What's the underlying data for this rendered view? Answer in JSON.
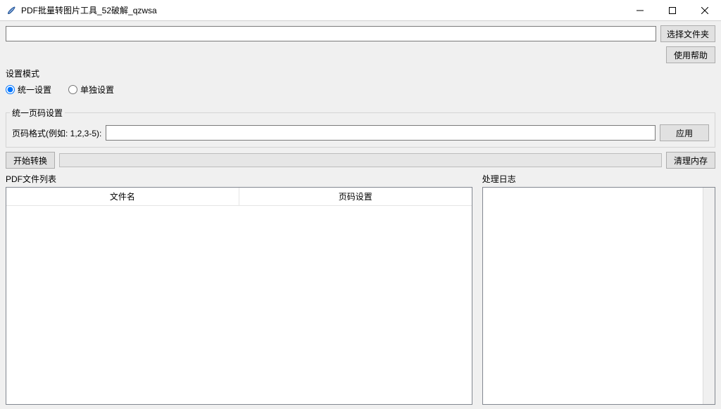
{
  "window": {
    "title": "PDF批量转图片工具_52破解_qzwsa"
  },
  "toolbar": {
    "path_value": "",
    "choose_folder_label": "选择文件夹",
    "help_label": "使用帮助"
  },
  "settings_mode": {
    "legend": "设置模式",
    "options": [
      {
        "label": "统一设置",
        "checked": true
      },
      {
        "label": "单独设置",
        "checked": false
      }
    ]
  },
  "page_settings": {
    "legend": "统一页码设置",
    "format_label": "页码格式(例如: 1,2,3-5):",
    "format_value": "",
    "apply_label": "应用"
  },
  "actions": {
    "start_label": "开始转换",
    "clear_label": "清理内存"
  },
  "panels": {
    "file_list_label": "PDF文件列表",
    "log_label": "处理日志",
    "columns": {
      "filename": "文件名",
      "page_setting": "页码设置"
    }
  }
}
